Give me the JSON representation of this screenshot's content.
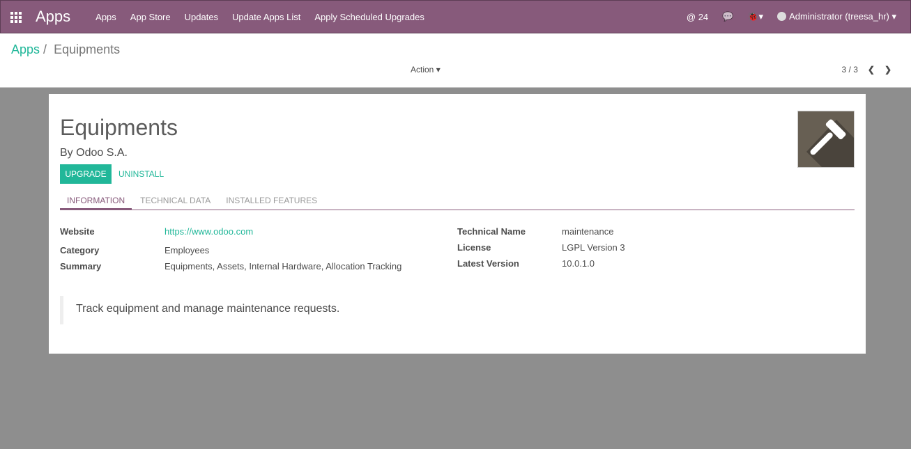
{
  "navbar": {
    "brand": "Apps",
    "menu": [
      "Apps",
      "App Store",
      "Updates",
      "Update Apps List",
      "Apply Scheduled Upgrades"
    ],
    "mentions": "@ 24",
    "user": "Administrator (treesa_hr)"
  },
  "breadcrumb": {
    "parent": "Apps",
    "separator": "/",
    "current": "Equipments"
  },
  "action_label": "Action",
  "pager": "3 / 3",
  "module": {
    "title": "Equipments",
    "author": "By Odoo S.A.",
    "upgrade": "UPGRADE",
    "uninstall": "UNINSTALL",
    "tabs": [
      "INFORMATION",
      "TECHNICAL DATA",
      "INSTALLED FEATURES"
    ],
    "left": [
      {
        "label": "Website",
        "value": "https://www.odoo.com"
      },
      {
        "label": "Category",
        "value": "Employees"
      },
      {
        "label": "Summary",
        "value": "Equipments, Assets, Internal Hardware, Allocation Tracking"
      }
    ],
    "right": [
      {
        "label": "Technical Name",
        "value": "maintenance"
      },
      {
        "label": "License",
        "value": "LGPL Version 3"
      },
      {
        "label": "Latest Version",
        "value": "10.0.1.0"
      }
    ],
    "description": "Track equipment and manage maintenance requests."
  },
  "colors": {
    "brand": "#875a7b",
    "accent": "#21b799"
  }
}
